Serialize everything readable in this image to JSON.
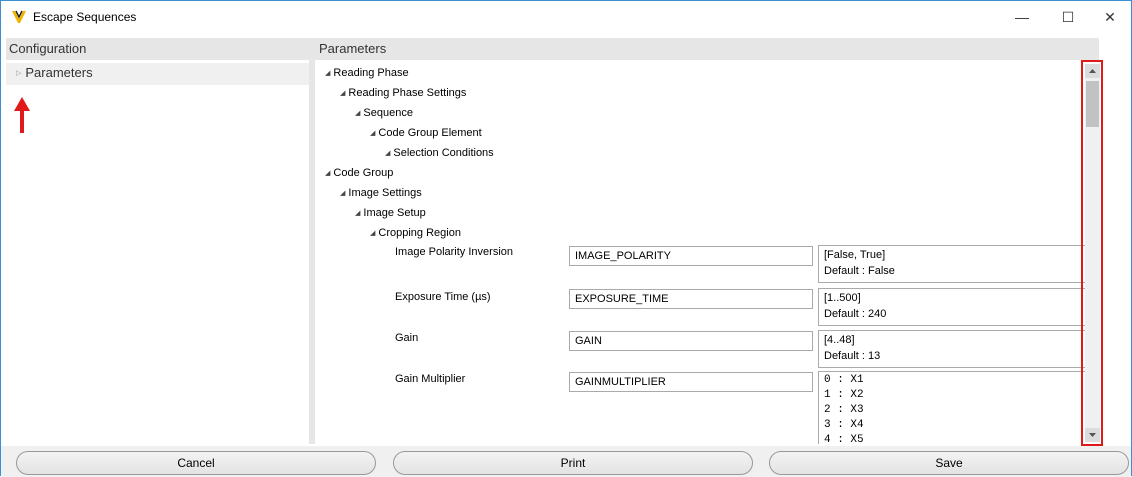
{
  "window": {
    "title": "Escape Sequences",
    "icon": "app-logo-icon",
    "controls": {
      "minimize": "—",
      "maximize": "☐",
      "close": "✕"
    }
  },
  "left": {
    "header": "Configuration",
    "tree_item": "Parameters",
    "annotation": "red-arrow-icon"
  },
  "right": {
    "header": "Parameters",
    "nodes": [
      "Reading Phase",
      "Reading Phase Settings",
      "Sequence",
      "Code Group Element",
      "Selection Conditions",
      "Code Group",
      "Image Settings",
      "Image Setup",
      "Cropping Region"
    ],
    "params": [
      {
        "label": "Image Polarity Inversion",
        "value": "IMAGE_POLARITY",
        "range": "[False, True]",
        "default": "Default :  False"
      },
      {
        "label": "Exposure Time (µs)",
        "value": "EXPOSURE_TIME",
        "range": "[1..500]",
        "default": "Default :  240"
      },
      {
        "label": "Gain",
        "value": "GAIN",
        "range": "[4..48]",
        "default": "Default :  13"
      },
      {
        "label": "Gain Multiplier",
        "value": "GAINMULTIPLIER",
        "options": [
          "0 : X1",
          "1 : X2",
          "2 : X3",
          "3 : X4",
          "4 : X5"
        ]
      }
    ]
  },
  "buttons": {
    "cancel": "Cancel",
    "print": "Print",
    "save": "Save"
  },
  "colors": {
    "highlight": "#e01a1a",
    "panel_header": "#e6e6e6"
  }
}
